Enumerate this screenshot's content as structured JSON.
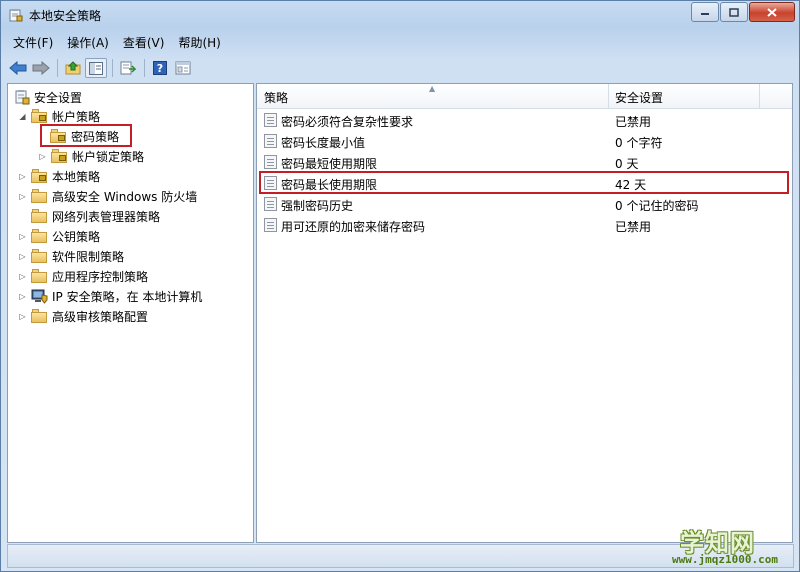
{
  "window": {
    "title": "本地安全策略"
  },
  "menu": [
    {
      "label": "文件(F)"
    },
    {
      "label": "操作(A)"
    },
    {
      "label": "查看(V)"
    },
    {
      "label": "帮助(H)"
    }
  ],
  "tree": {
    "root": "安全设置",
    "items": [
      {
        "label": "帐户策略"
      },
      {
        "label": "密码策略"
      },
      {
        "label": "帐户锁定策略"
      },
      {
        "label": "本地策略"
      },
      {
        "label": "高级安全 Windows 防火墙"
      },
      {
        "label": "网络列表管理器策略"
      },
      {
        "label": "公钥策略"
      },
      {
        "label": "软件限制策略"
      },
      {
        "label": "应用程序控制策略"
      },
      {
        "label": "IP 安全策略，在 本地计算机"
      },
      {
        "label": "高级审核策略配置"
      }
    ]
  },
  "list": {
    "columns": [
      "策略",
      "安全设置"
    ],
    "rows": [
      {
        "policy": "密码必须符合复杂性要求",
        "setting": "已禁用"
      },
      {
        "policy": "密码长度最小值",
        "setting": "0 个字符"
      },
      {
        "policy": "密码最短使用期限",
        "setting": "0 天"
      },
      {
        "policy": "密码最长使用期限",
        "setting": "42 天"
      },
      {
        "policy": "强制密码历史",
        "setting": "0 个记住的密码"
      },
      {
        "policy": "用可还原的加密来储存密码",
        "setting": "已禁用"
      }
    ]
  },
  "watermark": {
    "text": "学知网",
    "url": "www.jmqz1000.com"
  },
  "colors": {
    "highlight": "#c21f26",
    "accent": "#3c6fb3"
  }
}
